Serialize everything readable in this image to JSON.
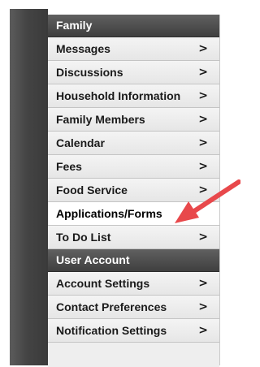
{
  "sections": [
    {
      "header": "Family",
      "items": [
        {
          "label": "Messages",
          "chevron": ">"
        },
        {
          "label": "Discussions",
          "chevron": ">"
        },
        {
          "label": "Household Information",
          "chevron": ">"
        },
        {
          "label": "Family Members",
          "chevron": ">"
        },
        {
          "label": "Calendar",
          "chevron": ">"
        },
        {
          "label": "Fees",
          "chevron": ">"
        },
        {
          "label": "Food Service",
          "chevron": ">"
        },
        {
          "label": "Applications/Forms",
          "chevron": "",
          "active": true
        },
        {
          "label": "To Do List",
          "chevron": ">"
        }
      ]
    },
    {
      "header": "User Account",
      "items": [
        {
          "label": "Account Settings",
          "chevron": ">"
        },
        {
          "label": "Contact Preferences",
          "chevron": ">"
        },
        {
          "label": "Notification Settings",
          "chevron": ">"
        }
      ]
    }
  ],
  "annotation": {
    "icon": "red-arrow-icon",
    "color": "#e8484b",
    "points_to": "Applications/Forms"
  },
  "colors": {
    "header_bg": "#4a4a4a",
    "rail_bg": "#444444",
    "item_bg": "#eeeeee",
    "active_bg": "#ffffff"
  }
}
